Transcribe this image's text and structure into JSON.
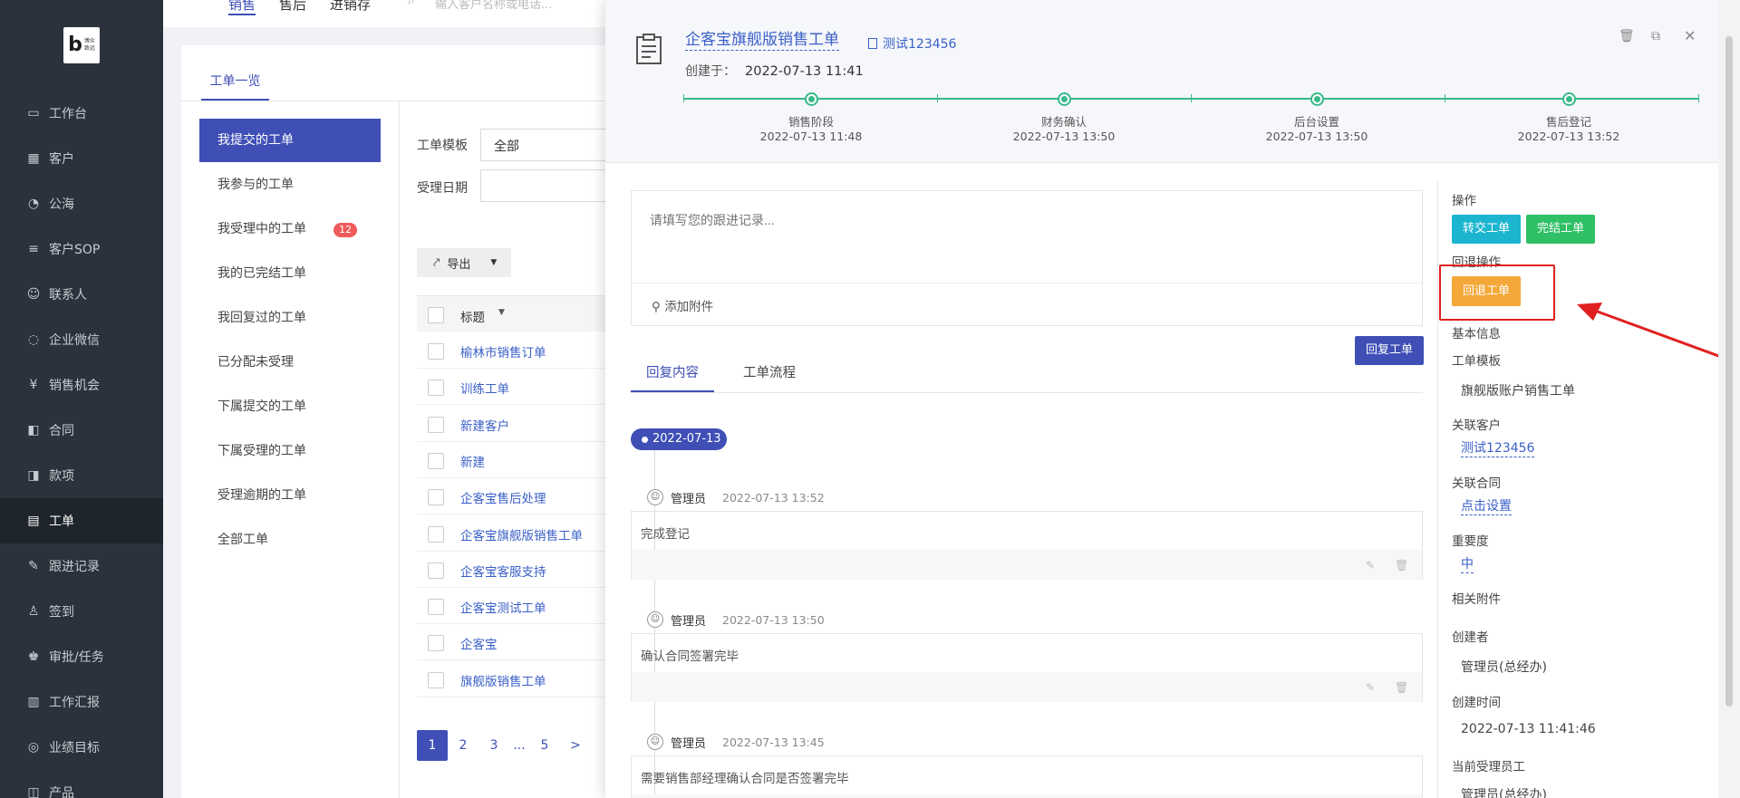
{
  "sidebar": {
    "logo_text": "博众致远",
    "items": [
      {
        "label": "工作台",
        "icon": "dashboard-icon"
      },
      {
        "label": "客户",
        "icon": "building-icon"
      },
      {
        "label": "公海",
        "icon": "ocean-icon"
      },
      {
        "label": "客户SOP",
        "icon": "sop-icon"
      },
      {
        "label": "联系人",
        "icon": "contact-icon"
      },
      {
        "label": "企业微信",
        "icon": "wechat-icon"
      },
      {
        "label": "销售机会",
        "icon": "money-bag-icon"
      },
      {
        "label": "合同",
        "icon": "contract-icon"
      },
      {
        "label": "款项",
        "icon": "payment-icon"
      },
      {
        "label": "工单",
        "icon": "clipboard-icon"
      },
      {
        "label": "跟进记录",
        "icon": "edit-icon"
      },
      {
        "label": "签到",
        "icon": "checkin-icon"
      },
      {
        "label": "审批/任务",
        "icon": "approval-icon"
      },
      {
        "label": "工作汇报",
        "icon": "report-icon"
      },
      {
        "label": "业绩目标",
        "icon": "target-icon"
      },
      {
        "label": "产品",
        "icon": "product-icon"
      }
    ],
    "active_index": 9
  },
  "topnav": {
    "items": [
      "销售",
      "售后",
      "进销存"
    ],
    "search_placeholder": "输入客户名称或电话..."
  },
  "list_page": {
    "tab": "工单一览",
    "filters": [
      {
        "label": "我提交的工单",
        "active": true
      },
      {
        "label": "我参与的工单"
      },
      {
        "label": "我受理中的工单",
        "badge": "12"
      },
      {
        "label": "我的已完结工单"
      },
      {
        "label": "我回复过的工单"
      },
      {
        "label": "已分配未受理"
      },
      {
        "label": "下属提交的工单"
      },
      {
        "label": "下属受理的工单"
      },
      {
        "label": "受理逾期的工单"
      },
      {
        "label": "全部工单"
      }
    ],
    "template_label": "工单模板",
    "template_value": "全部",
    "date_label": "受理日期",
    "export_label": "导出",
    "column_title": "标题",
    "rows": [
      "榆林市销售订单",
      "训练工单",
      "新建客户",
      "新建",
      "企客宝售后处理",
      "企客宝旗舰版销售工单",
      "企客宝客服支持",
      "企客宝测试工单",
      "企客宝",
      "旗舰版销售工单"
    ],
    "pager": [
      "1",
      "2",
      "3",
      "...",
      "5",
      ">"
    ]
  },
  "drawer": {
    "title": "企客宝旗舰版销售工单",
    "customer": "测试123456",
    "created_label": "创建于：",
    "created_value": "2022-07-13 11:41",
    "steps": [
      {
        "name": "销售阶段",
        "time": "2022-07-13 11:48"
      },
      {
        "name": "财务确认",
        "time": "2022-07-13 13:50"
      },
      {
        "name": "后台设置",
        "time": "2022-07-13 13:50"
      },
      {
        "name": "售后登记",
        "time": "2022-07-13 13:52"
      }
    ],
    "reply_placeholder": "请填写您的跟进记录...",
    "attach_label": "添加附件",
    "reply_button": "回复工单",
    "tabs": [
      "回复内容",
      "工单流程"
    ],
    "date_group": "2022-07-13",
    "entries": [
      {
        "user": "管理员",
        "time": "2022-07-13 13:52",
        "text": "完成登记"
      },
      {
        "user": "管理员",
        "time": "2022-07-13 13:50",
        "text": "确认合同签署完毕"
      },
      {
        "user": "管理员",
        "time": "2022-07-13 13:45",
        "text": "需要销售部经理确认合同是否签署完毕"
      }
    ],
    "right": {
      "ops_label": "操作",
      "transfer_btn": "转交工单",
      "finish_btn": "完结工单",
      "rollback_label": "回退操作",
      "rollback_btn": "回退工单",
      "basic_info": "基本信息",
      "template_label": "工单模板",
      "template_value": "旗舰版账户销售工单",
      "customer_label": "关联客户",
      "customer_value": "测试123456",
      "contract_label": "关联合同",
      "contract_value": "点击设置",
      "priority_label": "重要度",
      "priority_value": "中",
      "attach_label": "相关附件",
      "creator_label": "创建者",
      "creator_value": "管理员(总经办)",
      "created_time_label": "创建时间",
      "created_time_value": "2022-07-13 11:41:46",
      "handler_label": "当前受理员工",
      "handler_value": "管理员(总经办)"
    }
  },
  "colors": {
    "primary": "#3f4fb5",
    "success": "#39b98a",
    "warning": "#f4a83a",
    "highlight": "#e02020"
  }
}
